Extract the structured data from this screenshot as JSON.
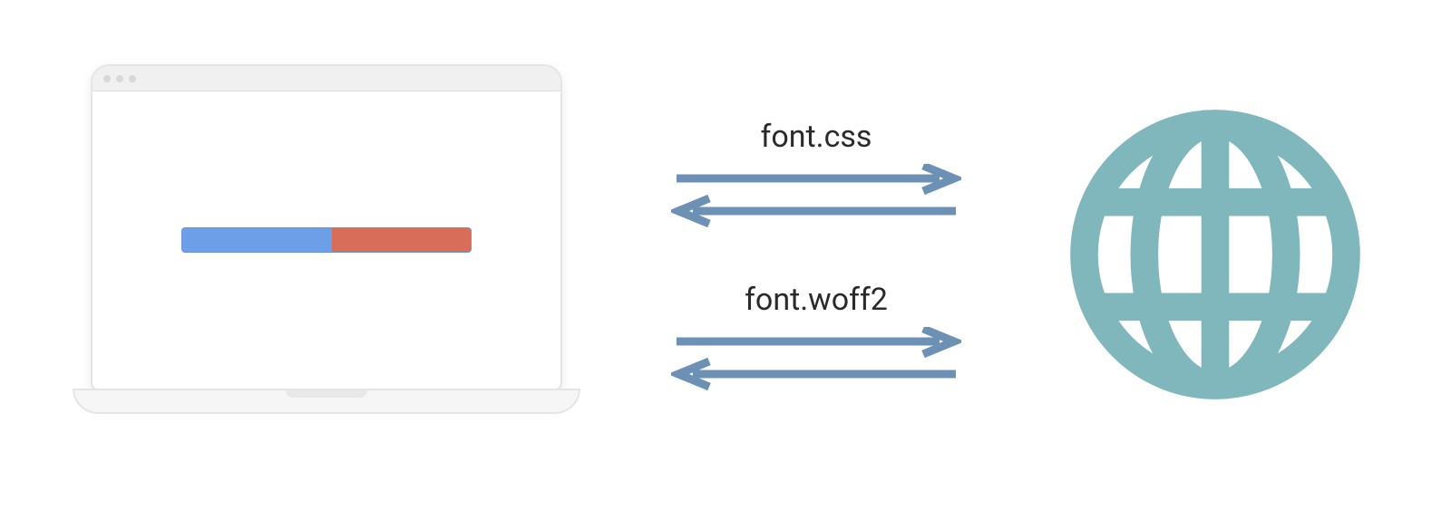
{
  "labels": {
    "request1": "font.css",
    "request2": "font.woff2"
  },
  "colors": {
    "arrow": "#6c91b5",
    "globe": "#7fb7bd",
    "progress_bg": "#6d9ee8",
    "progress_fill": "#d86e59"
  }
}
